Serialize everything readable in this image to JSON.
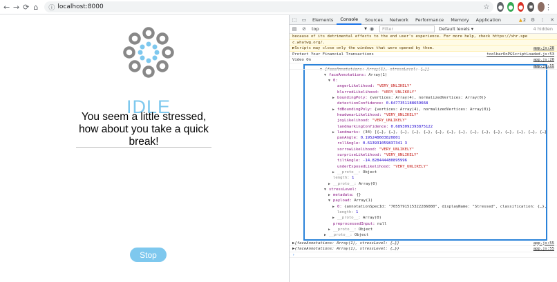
{
  "browser": {
    "url": "localhost:8000"
  },
  "app": {
    "status_title": "IDLE",
    "message": "You seem a little stressed, how about you take a quick break!",
    "stop_label": "Stop",
    "accent": "#7ec8ee"
  },
  "devtools": {
    "tabs": [
      "Elements",
      "Console",
      "Sources",
      "Network",
      "Performance",
      "Memory",
      "Application"
    ],
    "active_tab": "Console",
    "warning_count": "2",
    "context": "top",
    "filter_placeholder": "Filter",
    "levels": "Default levels ▾",
    "hidden_count": "4 hidden",
    "lines": [
      {
        "text": "because of its detrimental effects to the end user's experience. For more help, check https://xhr.spe",
        "src": "",
        "type": "warn"
      },
      {
        "text": "c.whatwg.org/.",
        "src": "",
        "type": "warn"
      },
      {
        "text": "▶Scripts may close only the windows that were opened by them.",
        "src": "app.js:28",
        "type": "warn"
      },
      {
        "text": "Protect Your Financial Transactions",
        "src": "toolbarOnPGScriptLoaded.js:53",
        "type": "log"
      },
      {
        "text": "Video On",
        "src": "app.js:20",
        "type": "log"
      },
      {
        "text": "",
        "src": "app.js:55",
        "type": "log"
      }
    ],
    "tree": [
      {
        "indent": 0,
        "tri": "▼",
        "text": "{faceAnnotations: Array(1), stressLevel: {…}}",
        "italic": true
      },
      {
        "indent": 1,
        "tri": "▼",
        "key": "faceAnnotations",
        "text": "Array(1)"
      },
      {
        "indent": 2,
        "tri": "▼",
        "key": "0",
        "text": ""
      },
      {
        "indent": 3,
        "tri": "",
        "key": "angerLikelihood",
        "str": "\"VERY_UNLIKELY\""
      },
      {
        "indent": 3,
        "tri": "",
        "key": "blurredLikelihood",
        "str": "\"VERY_UNLIKELY\""
      },
      {
        "indent": 3,
        "tri": "▶",
        "key": "boundingPoly",
        "text": "{vertices: Array(4), normalizedVertices: Array(0)}"
      },
      {
        "indent": 3,
        "tri": "",
        "key": "detectionConfidence",
        "num": "0.6477351188659668"
      },
      {
        "indent": 3,
        "tri": "▶",
        "key": "fdBoundingPoly",
        "text": "{vertices: Array(4), normalizedVertices: Array(0)}"
      },
      {
        "indent": 3,
        "tri": "",
        "key": "headwearLikelihood",
        "str": "\"VERY_UNLIKELY\""
      },
      {
        "indent": 3,
        "tri": "",
        "key": "joyLikelihood",
        "str": "\"VERY_UNLIKELY\""
      },
      {
        "indent": 3,
        "tri": "",
        "key": "landmarkingConfidence",
        "num": "0.6893092393875122"
      },
      {
        "indent": 3,
        "tri": "▶",
        "key": "landmarks",
        "text": "(34) [{…}, {…}, {…}, {…}, {…}, {…}, {…}, {…}, {…}, {…}, {…}, {…}, {…}, {…}, {…}, {…"
      },
      {
        "indent": 3,
        "tri": "",
        "key": "panAngle",
        "num": "0.195248603820801"
      },
      {
        "indent": 3,
        "tri": "",
        "key": "rollAngle",
        "num": "0.613931059837341 3"
      },
      {
        "indent": 3,
        "tri": "",
        "key": "sorrowLikelihood",
        "str": "\"VERY_UNLIKELY\""
      },
      {
        "indent": 3,
        "tri": "",
        "key": "surpriseLikelihood",
        "str": "\"VERY_UNLIKELY\""
      },
      {
        "indent": 3,
        "tri": "",
        "key": "tiltAngle",
        "num": "-14.828444480895996"
      },
      {
        "indent": 3,
        "tri": "",
        "key": "underExposedLikelihood",
        "str": "\"VERY_UNLIKELY\""
      },
      {
        "indent": 3,
        "tri": "▶",
        "key": "__proto__",
        "text": "Object",
        "grey": true
      },
      {
        "indent": 2,
        "tri": "",
        "key": "length",
        "num": "1",
        "grey": true
      },
      {
        "indent": 2,
        "tri": "▶",
        "key": "__proto__",
        "text": "Array(0)",
        "grey": true
      },
      {
        "indent": 1,
        "tri": "▼",
        "key": "stressLevel",
        "text": ""
      },
      {
        "indent": 2,
        "tri": "▶",
        "key": "metadata",
        "text": "{}"
      },
      {
        "indent": 2,
        "tri": "▼",
        "key": "payload",
        "text": "Array(1)"
      },
      {
        "indent": 3,
        "tri": "▶",
        "key": "0",
        "text": "{annotationSpecId: \"7055791515322286080\", displayName: \"Stressed\", classification: {…}, de…"
      },
      {
        "indent": 3,
        "tri": "",
        "key": "length",
        "num": "1",
        "grey": true
      },
      {
        "indent": 3,
        "tri": "▶",
        "key": "__proto__",
        "text": "Array(0)",
        "grey": true
      },
      {
        "indent": 2,
        "tri": "",
        "key": "preprocessedInput",
        "text": "null"
      },
      {
        "indent": 2,
        "tri": "▶",
        "key": "__proto__",
        "text": "Object",
        "grey": true
      },
      {
        "indent": 1,
        "tri": "▶",
        "key": "__proto__",
        "text": "Object",
        "grey": true
      }
    ],
    "after_lines": [
      {
        "text": "▶{faceAnnotations: Array(1), stressLevel: {…}}",
        "src": "app.js:55"
      },
      {
        "text": "▶{faceAnnotations: Array(1), stressLevel: {…}}",
        "src": "app.js:55"
      }
    ],
    "prompt": "›"
  }
}
